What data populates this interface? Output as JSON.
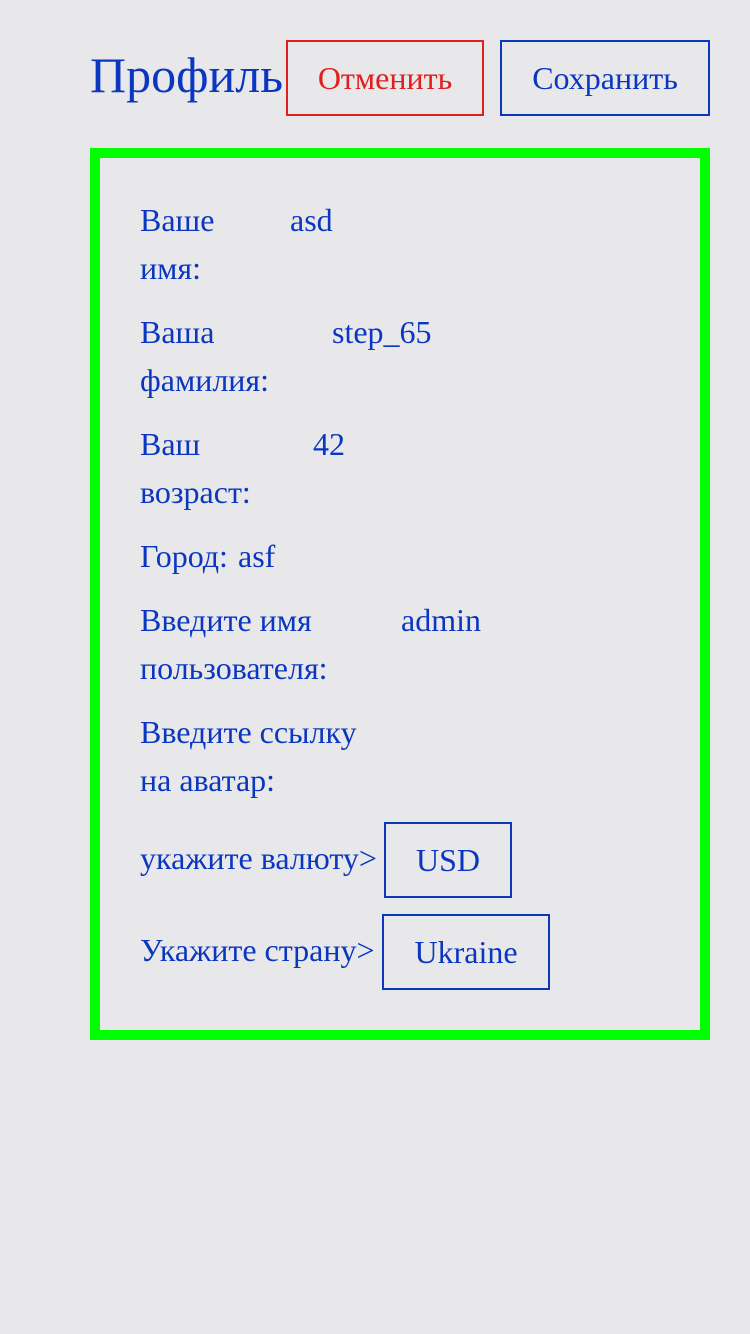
{
  "header": {
    "title": "Профиль",
    "cancel_label": "Отменить",
    "save_label": "Сохранить"
  },
  "form": {
    "first_name": {
      "label_line1": "Ваше",
      "label_line2": "имя:",
      "value": "asd"
    },
    "last_name": {
      "label_line1": "Ваша",
      "label_line2": "фамилия:",
      "value": "step_65"
    },
    "age": {
      "label_line1": "Ваш",
      "label_line2": "возраст:",
      "value": "42"
    },
    "city": {
      "label": "Город:",
      "value": "asf"
    },
    "username": {
      "label_line1": "Введите имя",
      "label_line2": "пользователя:",
      "value": "admin"
    },
    "avatar": {
      "label_line1": "Введите ссылку",
      "label_line2": "на аватар:"
    },
    "currency": {
      "label": "укажите валюту>",
      "value": "USD"
    },
    "country": {
      "label": "Укажите страну>",
      "value": "Ukraine"
    }
  },
  "colors": {
    "text": "#0a36c0",
    "cancel": "#e02020",
    "panel_border": "#00ff00",
    "background": "#e8e8ea"
  }
}
